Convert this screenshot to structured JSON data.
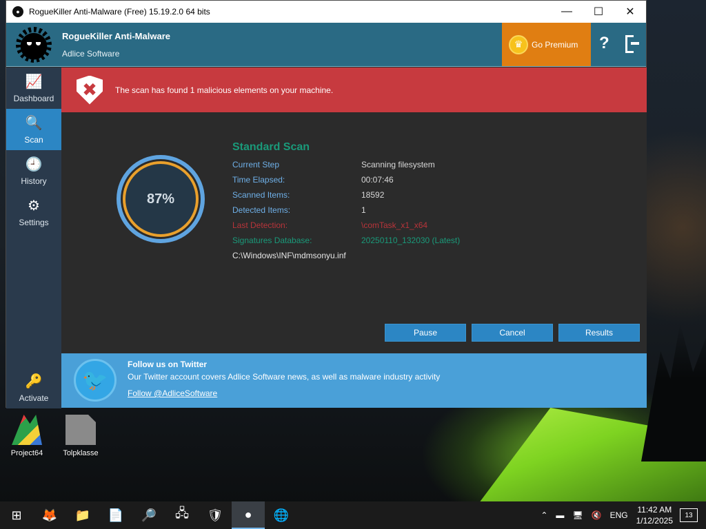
{
  "window": {
    "title": "RogueKiller Anti-Malware (Free) 15.19.2.0 64 bits",
    "controls": {
      "minimize": "—",
      "maximize": "☐",
      "close": "✕"
    }
  },
  "header": {
    "app_name": "RogueKiller Anti-Malware",
    "company": "Adlice Software",
    "premium_label": "Go Premium",
    "help_glyph": "?"
  },
  "sidebar": {
    "items": [
      {
        "label": "Dashboard",
        "icon": "chart-icon",
        "glyph": "📈"
      },
      {
        "label": "Scan",
        "icon": "search-icon",
        "glyph": "🔍"
      },
      {
        "label": "History",
        "icon": "clock-icon",
        "glyph": "🕘"
      },
      {
        "label": "Settings",
        "icon": "gear-icon",
        "glyph": "⚙"
      }
    ],
    "activate": {
      "label": "Activate",
      "icon": "key-icon",
      "glyph": "🔑"
    }
  },
  "alert": {
    "message": "The scan has found 1 malicious elements on your machine.",
    "glyph": "✖"
  },
  "scan": {
    "progress_text": "87%",
    "progress": 0.87,
    "title": "Standard Scan",
    "rows": [
      {
        "key": "Current Step",
        "value": "Scanning filesystem"
      },
      {
        "key": "Time Elapsed:",
        "value": "00:07:46"
      },
      {
        "key": "Scanned Items:",
        "value": "18592"
      },
      {
        "key": "Detected Items:",
        "value": "1"
      },
      {
        "key": "Last Detection:",
        "value": "\\comTask_x1_x64"
      },
      {
        "key": "Signatures Database:",
        "value": "20250110_132030 (Latest)"
      }
    ],
    "current_file": "C:\\Windows\\INF\\mdmsonyu.inf",
    "buttons": {
      "pause": "Pause",
      "cancel": "Cancel",
      "results": "Results"
    }
  },
  "twitter": {
    "title": "Follow us on Twitter",
    "description": "Our Twitter account covers Adlice Software news, as well as malware industry activity",
    "link": "Follow @AdliceSoftware",
    "glyph": "🐦"
  },
  "desktop": {
    "icons": [
      {
        "label": "Project64"
      },
      {
        "label": "Tolpklasse"
      }
    ]
  },
  "taskbar": {
    "language": "ENG",
    "time": "11:42 AM",
    "date": "1/12/2025",
    "notification_count": "13"
  },
  "colors": {
    "header": "#2a6a84",
    "alert": "#c73a3f",
    "accent": "#2c86c4",
    "premium": "#e07e12",
    "scan_title": "#1a9a7a",
    "twitter": "#4aa0d8"
  }
}
